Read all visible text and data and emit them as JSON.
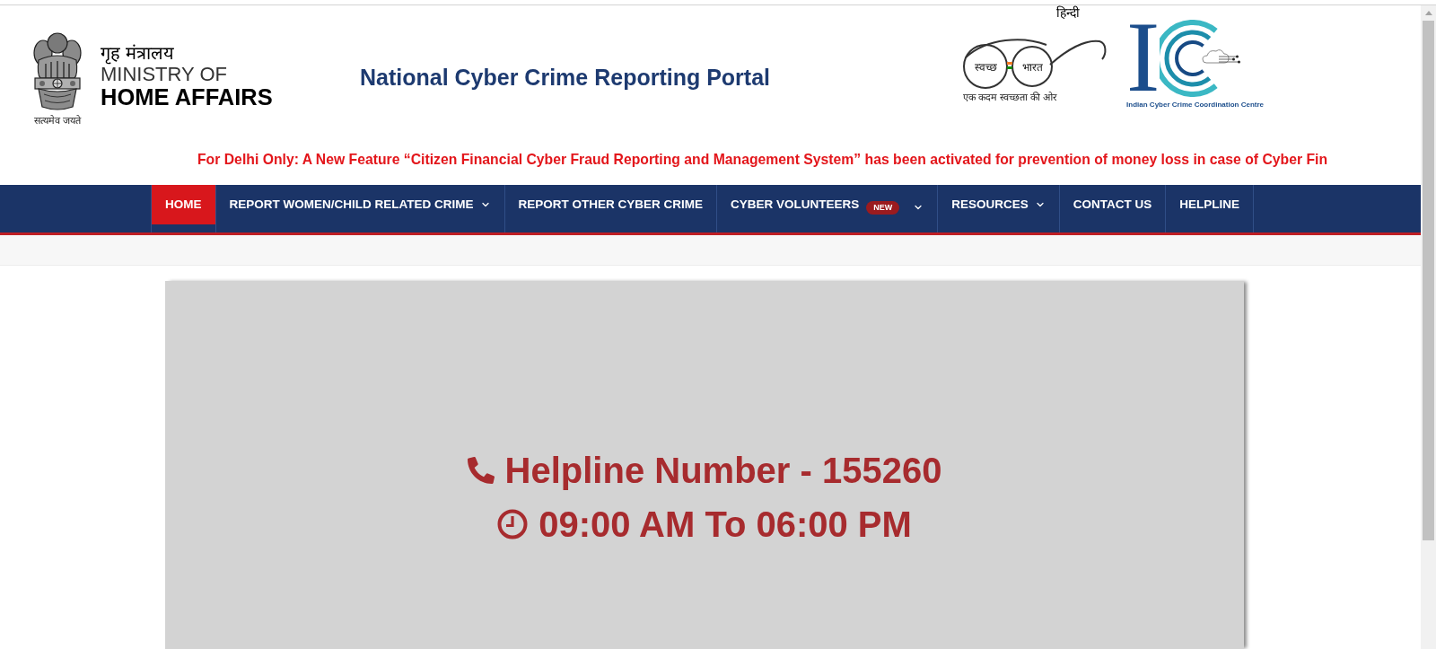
{
  "header": {
    "emblem_motto": "सत्यमेव जयते",
    "ministry_hindi": "गृह मंत्रालय",
    "ministry_line1": "MINISTRY OF",
    "ministry_line2": "HOME AFFAIRS",
    "title": "National Cyber Crime Reporting Portal",
    "language_link": "हिन्दी",
    "swachh_logo": {
      "left_word": "स्वच्छ",
      "right_word": "भारत",
      "tagline": "एक कदम स्वच्छता की ओर"
    },
    "i4c_logo": {
      "letter": "I",
      "caption": "Indian Cyber Crime Coordination Centre"
    }
  },
  "announcement": "For Delhi Only: A New Feature “Citizen Financial Cyber Fraud Reporting and Management System” has been activated for prevention of money loss in case of Cyber Fin",
  "nav": {
    "items": [
      {
        "label": "HOME",
        "selected": true,
        "dropdown": false
      },
      {
        "label": "REPORT WOMEN/CHILD RELATED CRIME",
        "selected": false,
        "dropdown": true
      },
      {
        "label": "REPORT OTHER CYBER CRIME",
        "selected": false,
        "dropdown": false
      },
      {
        "label": "CYBER VOLUNTEERS",
        "selected": false,
        "dropdown": true,
        "badge": "NEW"
      },
      {
        "label": "RESOURCES",
        "selected": false,
        "dropdown": true
      },
      {
        "label": "CONTACT US",
        "selected": false,
        "dropdown": false
      },
      {
        "label": "HELPLINE",
        "selected": false,
        "dropdown": false
      }
    ]
  },
  "helpline": {
    "number_line": "Helpline Number - 155260",
    "hours_line": "09:00 AM To 06:00 PM"
  }
}
